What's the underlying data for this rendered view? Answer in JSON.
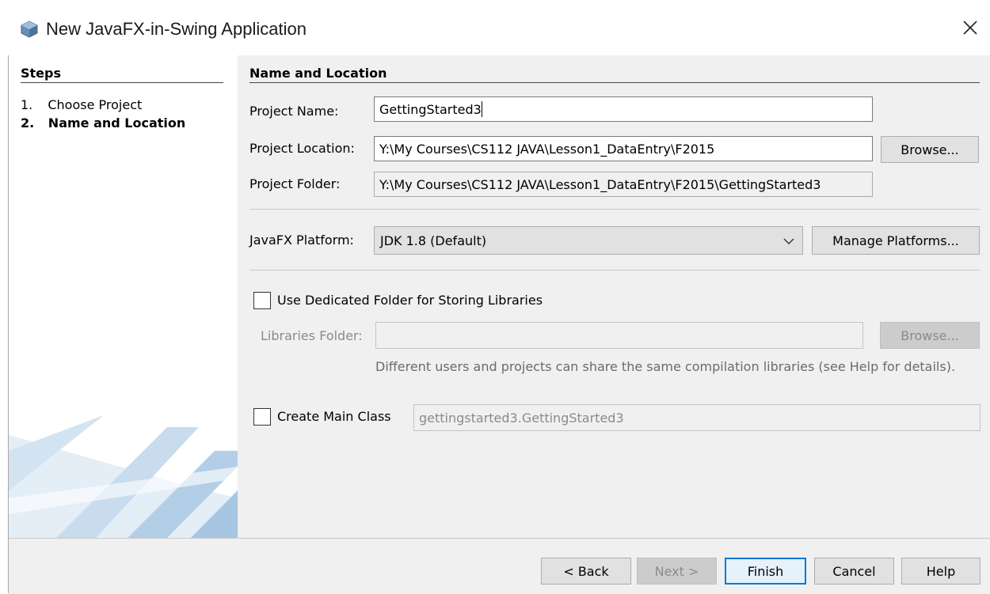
{
  "window": {
    "title": "New JavaFX-in-Swing Application"
  },
  "steps": {
    "heading": "Steps",
    "items": [
      {
        "num": "1.",
        "label": "Choose Project",
        "current": false
      },
      {
        "num": "2.",
        "label": "Name and Location",
        "current": true
      }
    ]
  },
  "main": {
    "heading": "Name and Location",
    "project_name": {
      "label": "Project Name:",
      "value": "GettingStarted3"
    },
    "project_location": {
      "label": "Project Location:",
      "value": "Y:\\My Courses\\CS112 JAVA\\Lesson1_DataEntry\\F2015",
      "browse": "Browse..."
    },
    "project_folder": {
      "label": "Project Folder:",
      "value": "Y:\\My Courses\\CS112 JAVA\\Lesson1_DataEntry\\F2015\\GettingStarted3"
    },
    "platform": {
      "label": "JavaFX Platform:",
      "value": "JDK 1.8 (Default)",
      "manage": "Manage Platforms..."
    },
    "dedicated_folder": {
      "label": "Use Dedicated Folder for Storing Libraries",
      "checked": false
    },
    "libraries_folder": {
      "label": "Libraries Folder:",
      "value": "",
      "browse": "Browse..."
    },
    "libraries_help": "Different users and projects can share the same compilation libraries (see Help for details).",
    "main_class": {
      "label": "Create Main Class",
      "value": "gettingstarted3.GettingStarted3",
      "checked": false
    }
  },
  "buttons": {
    "back": "< Back",
    "next": "Next >",
    "finish": "Finish",
    "cancel": "Cancel",
    "help": "Help"
  },
  "colors": {
    "accent": "#0078d7",
    "panel": "#f0f0f0",
    "graphic": "#bcd6ea"
  }
}
